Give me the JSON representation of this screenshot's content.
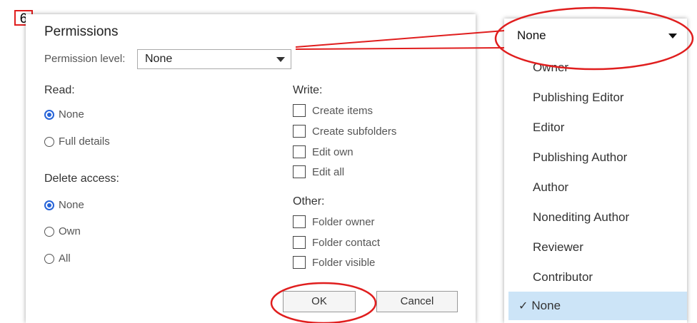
{
  "step_number": "6",
  "dialog": {
    "title": "Permissions",
    "permission_level_label": "Permission level:",
    "permission_level_value": "None",
    "read": {
      "label": "Read:",
      "options": [
        {
          "label": "None",
          "selected": true
        },
        {
          "label": "Full details",
          "selected": false
        }
      ]
    },
    "delete": {
      "label": "Delete access:",
      "options": [
        {
          "label": "None",
          "selected": true
        },
        {
          "label": "Own",
          "selected": false
        },
        {
          "label": "All",
          "selected": false
        }
      ]
    },
    "write": {
      "label": "Write:",
      "items": [
        "Create items",
        "Create subfolders",
        "Edit own",
        "Edit all"
      ]
    },
    "other": {
      "label": "Other:",
      "items": [
        "Folder owner",
        "Folder contact",
        "Folder visible"
      ]
    },
    "ok_label": "OK",
    "cancel_label": "Cancel"
  },
  "dropdown": {
    "selected_value": "None",
    "options": [
      "Owner",
      "Publishing Editor",
      "Editor",
      "Publishing Author",
      "Author",
      "Nonediting Author",
      "Reviewer",
      "Contributor",
      "None"
    ],
    "checked_option": "None",
    "check_glyph": "✓"
  },
  "colors": {
    "annotation": "#e01e1e",
    "radio_accent": "#2764d8",
    "selected_item_bg": "#cce4f7"
  }
}
